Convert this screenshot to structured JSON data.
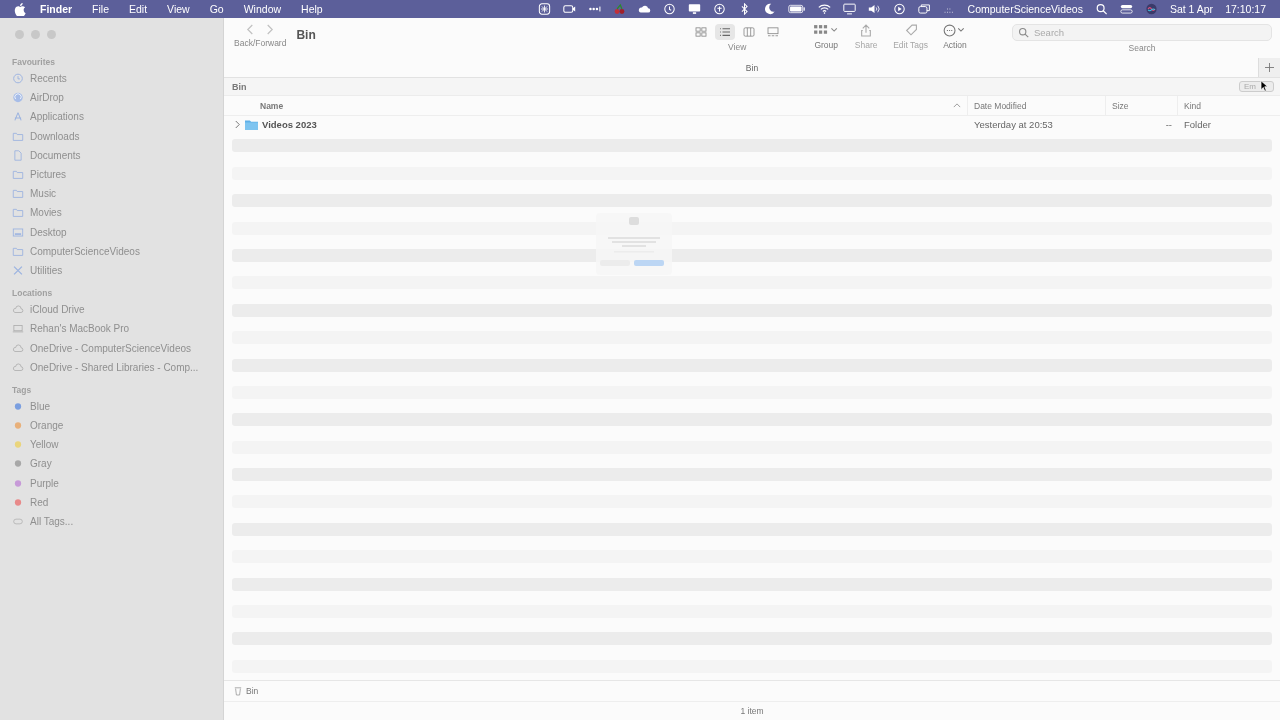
{
  "menu_bar": {
    "app": "Finder",
    "menus": [
      "File",
      "Edit",
      "View",
      "Go",
      "Window",
      "Help"
    ],
    "status_text": "ComputerScienceVideos",
    "date": "Sat 1 Apr",
    "time": "17:10:17"
  },
  "toolbar": {
    "nav_label": "Back/Forward",
    "title": "Bin",
    "view_modes": [
      {
        "kind": "icons",
        "selected": false
      },
      {
        "kind": "list",
        "selected": true
      },
      {
        "kind": "columns",
        "selected": false
      },
      {
        "kind": "gallery",
        "selected": false
      }
    ],
    "view_label": "View",
    "actions": [
      {
        "kind": "group",
        "label": "Group",
        "disabled": false
      },
      {
        "kind": "share",
        "label": "Share",
        "disabled": true
      },
      {
        "kind": "tag",
        "label": "Edit Tags",
        "disabled": true
      },
      {
        "kind": "action",
        "label": "Action",
        "disabled": false
      }
    ],
    "search": {
      "placeholder": "Search",
      "label": "Search"
    }
  },
  "tab": {
    "label": "Bin"
  },
  "path_header": {
    "title": "Bin",
    "button": "Em"
  },
  "sidebar": {
    "sections": [
      {
        "title": "Favourites",
        "items": [
          {
            "label": "Recents",
            "kind": "clock"
          },
          {
            "label": "AirDrop",
            "kind": "airdrop"
          },
          {
            "label": "Applications",
            "kind": "apps"
          },
          {
            "label": "Downloads",
            "kind": "folder"
          },
          {
            "label": "Documents",
            "kind": "doc"
          },
          {
            "label": "Pictures",
            "kind": "folder"
          },
          {
            "label": "Music",
            "kind": "folder"
          },
          {
            "label": "Movies",
            "kind": "folder"
          },
          {
            "label": "Desktop",
            "kind": "desktop"
          },
          {
            "label": "ComputerScienceVideos",
            "kind": "folder"
          },
          {
            "label": "Utilities",
            "kind": "tools"
          }
        ]
      },
      {
        "title": "Locations",
        "items": [
          {
            "label": "iCloud Drive",
            "kind": "cloud"
          },
          {
            "label": "Rehan's MacBook Pro",
            "kind": "laptop"
          },
          {
            "label": "OneDrive - ComputerScienceVideos",
            "kind": "cloud"
          },
          {
            "label": "OneDrive - Shared Libraries - Comp...",
            "kind": "cloud"
          }
        ]
      },
      {
        "title": "Tags",
        "items": [
          {
            "label": "Blue",
            "kind": "tag",
            "color": "#7b9fe0"
          },
          {
            "label": "Orange",
            "kind": "tag",
            "color": "#e8b07a"
          },
          {
            "label": "Yellow",
            "kind": "tag",
            "color": "#ead57c"
          },
          {
            "label": "Gray",
            "kind": "tag",
            "color": "#a8a8a8"
          },
          {
            "label": "Purple",
            "kind": "tag",
            "color": "#c79ad8"
          },
          {
            "label": "Red",
            "kind": "tag",
            "color": "#e88a8a"
          },
          {
            "label": "All Tags...",
            "kind": "alltags"
          }
        ]
      }
    ]
  },
  "table": {
    "columns": [
      {
        "label": "Name",
        "sorted": true
      },
      {
        "label": "Date Modified",
        "sorted": false
      },
      {
        "label": "Size",
        "sorted": false
      },
      {
        "label": "Kind",
        "sorted": false
      }
    ],
    "rows": [
      {
        "name": "Videos 2023",
        "expanded": false,
        "date": "Yesterday at 20:53",
        "size": "--",
        "kind": "Folder"
      }
    ]
  },
  "path_bar": {
    "label": "Bin"
  },
  "status_bar": {
    "text": "1 item"
  }
}
